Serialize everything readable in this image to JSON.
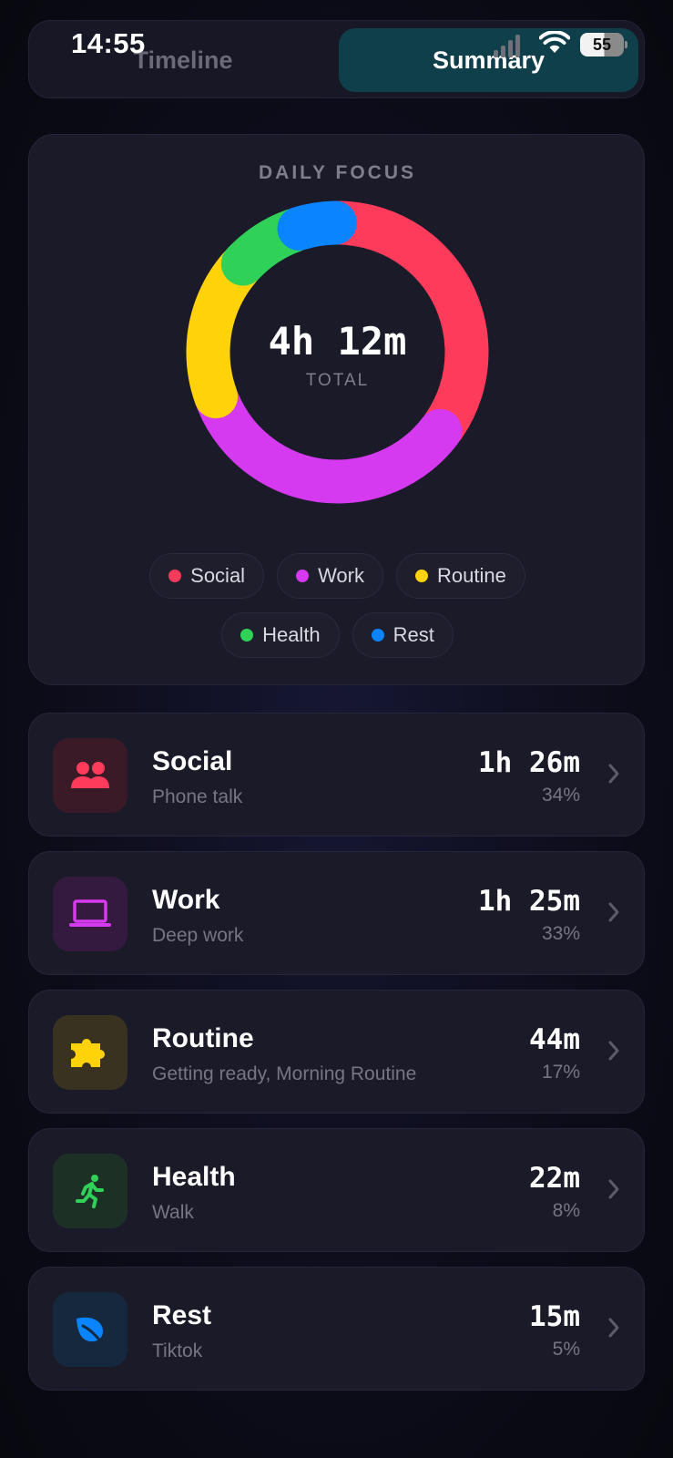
{
  "status_bar": {
    "time": "14:55",
    "battery": "55"
  },
  "segmented": {
    "tabs": [
      {
        "label": "Timeline",
        "active": false
      },
      {
        "label": "Summary",
        "active": true
      }
    ]
  },
  "focus": {
    "title": "DAILY FOCUS",
    "total_value": "4h 12m",
    "total_label": "TOTAL",
    "legend": [
      {
        "label": "Social",
        "color": "#ff3b5c"
      },
      {
        "label": "Work",
        "color": "#d63af0"
      },
      {
        "label": "Routine",
        "color": "#ffd20a"
      },
      {
        "label": "Health",
        "color": "#30d158"
      },
      {
        "label": "Rest",
        "color": "#0a84ff"
      }
    ]
  },
  "chart_data": {
    "type": "pie",
    "categories": [
      "Social",
      "Work",
      "Routine",
      "Health",
      "Rest"
    ],
    "values": [
      34,
      33,
      17,
      8,
      5
    ],
    "colors": [
      "#ff3b5c",
      "#d63af0",
      "#ffd20a",
      "#30d158",
      "#0a84ff"
    ]
  },
  "categories": [
    {
      "name": "Social",
      "subtitle": "Phone talk",
      "time": "1h 26m",
      "percent": "34%",
      "color": "#ff3b5c",
      "icon_bg": "#3a1a26",
      "icon": "people-icon"
    },
    {
      "name": "Work",
      "subtitle": "Deep work",
      "time": "1h 25m",
      "percent": "33%",
      "color": "#d63af0",
      "icon_bg": "#331a3e",
      "icon": "laptop-icon"
    },
    {
      "name": "Routine",
      "subtitle": "Getting ready, Morning Routine",
      "time": "44m",
      "percent": "17%",
      "color": "#ffd20a",
      "icon_bg": "#3a3220",
      "icon": "puzzle-icon"
    },
    {
      "name": "Health",
      "subtitle": "Walk",
      "time": "22m",
      "percent": "8%",
      "color": "#30d158",
      "icon_bg": "#1c3026",
      "icon": "runner-icon"
    },
    {
      "name": "Rest",
      "subtitle": "Tiktok",
      "time": "15m",
      "percent": "5%",
      "color": "#0a84ff",
      "icon_bg": "#16283e",
      "icon": "leaf-icon"
    }
  ]
}
